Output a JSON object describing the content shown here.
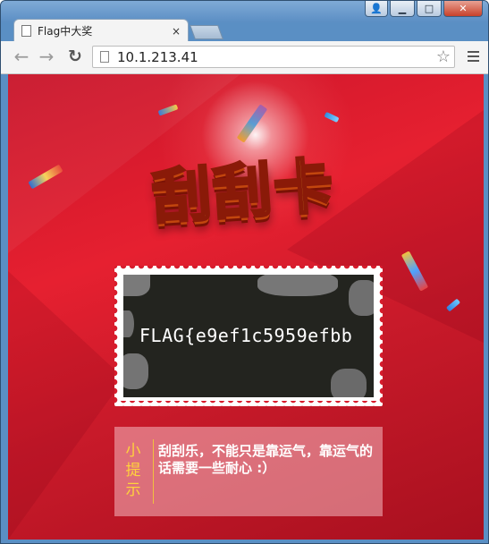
{
  "browser": {
    "tab_title": "Flag中大奖",
    "tab_close": "×",
    "address": "10.1.213.41",
    "back_glyph": "←",
    "forward_glyph": "→",
    "reload_glyph": "↻",
    "star_glyph": "☆",
    "window_controls": {
      "user": "👤",
      "minimize": "▁",
      "maximize": "□",
      "close": "✕"
    }
  },
  "page": {
    "title": "刮刮卡",
    "scratch_card": {
      "revealed_text": "FLAG{e9ef1c5959efbb"
    },
    "tip": {
      "label": "小提示",
      "text": "刮刮乐，不能只是靠运气，靠运气的话需要一些耐心 :）"
    }
  },
  "colors": {
    "background_red": "#d01a2a",
    "title_gold": "#ffd33a",
    "scratch_dark": "#23241f",
    "tip_label_yellow": "#ffd23c"
  }
}
